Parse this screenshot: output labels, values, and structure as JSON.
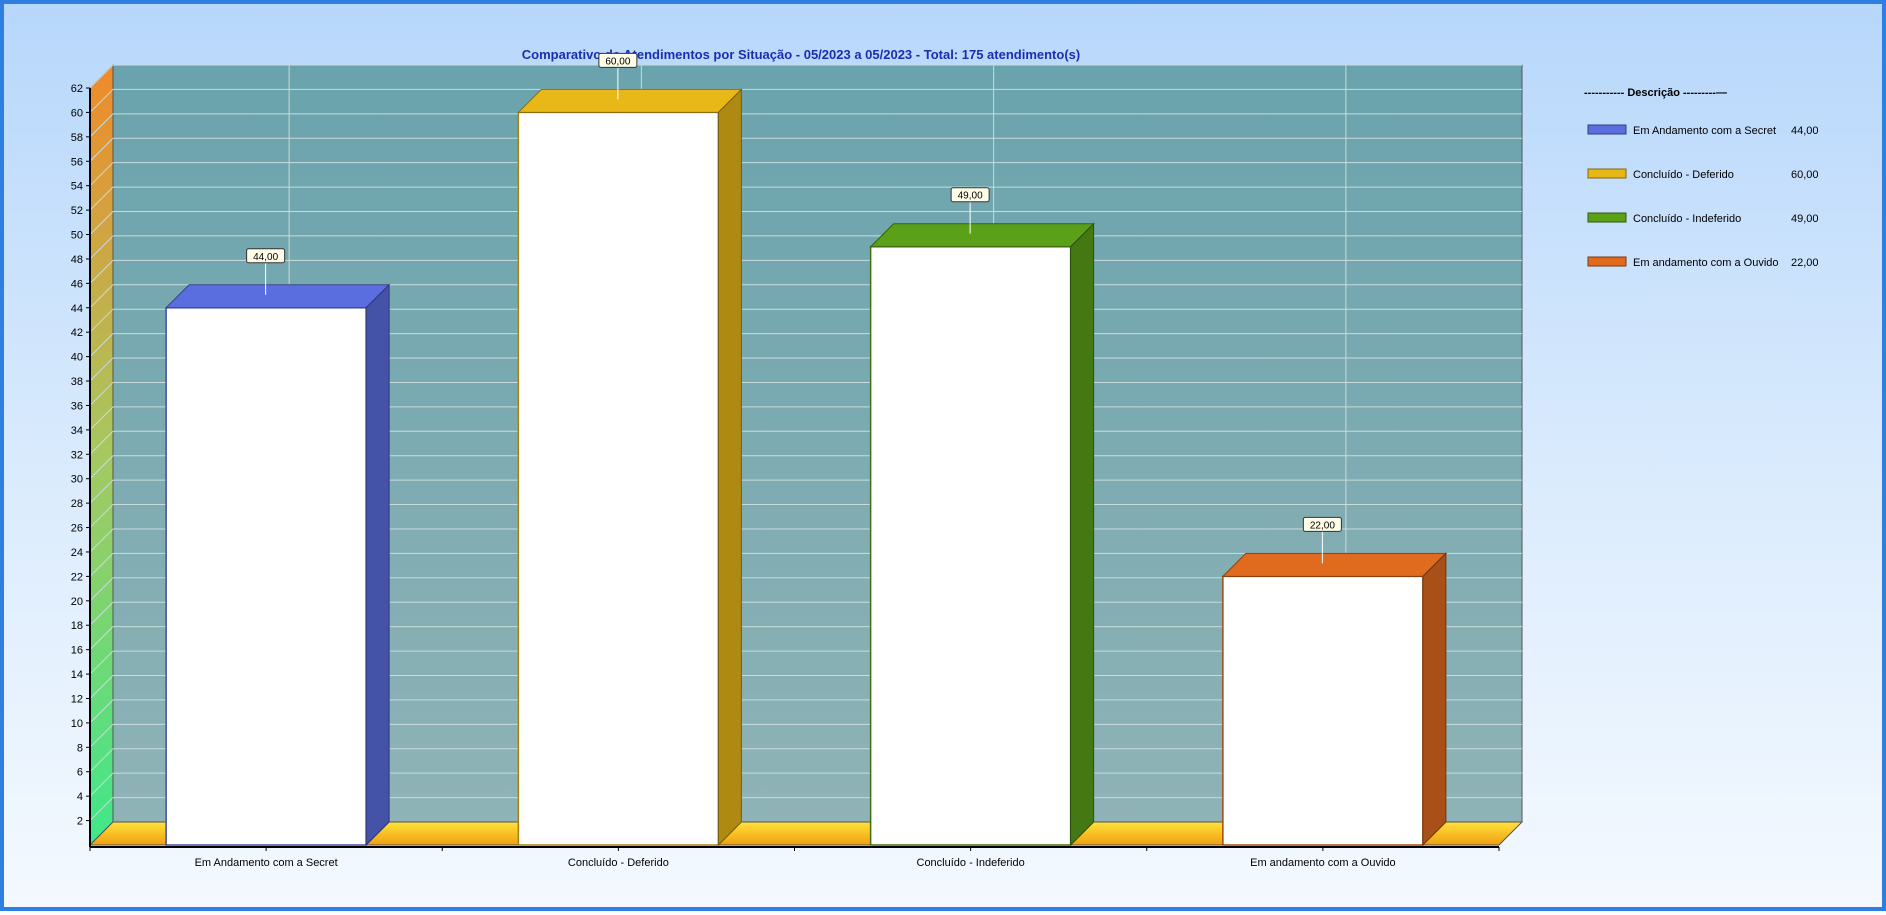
{
  "chart_data": {
    "type": "bar",
    "title": "Comparativo  de  Atendimentos  por  Situação  -  05/2023  a  05/2023  -  Total:  175  atendimento(s)",
    "categories": [
      "Em Andamento com a Secret",
      "Concluído - Deferido",
      "Concluído - Indeferido",
      "Em andamento com a Ouvido"
    ],
    "values": [
      44,
      60,
      49,
      22
    ],
    "data_labels": [
      "44,00",
      "60,00",
      "49,00",
      "22,00"
    ],
    "ylim": [
      0,
      62
    ],
    "yticks": [
      2,
      4,
      6,
      8,
      10,
      12,
      14,
      16,
      18,
      20,
      22,
      24,
      26,
      28,
      30,
      32,
      34,
      36,
      38,
      40,
      42,
      44,
      46,
      48,
      50,
      52,
      54,
      56,
      58,
      60,
      62
    ],
    "grid": true,
    "colors": [
      "#5a6ee0",
      "#e8b818",
      "#5aa018",
      "#e06a1e"
    ],
    "legend": {
      "position": "right",
      "heading": "----------- Descrição ---------—",
      "entries": [
        {
          "label": "Em Andamento com a Secret",
          "value": "44,00"
        },
        {
          "label": "Concluído - Deferido",
          "value": "60,00"
        },
        {
          "label": "Concluído - Indeferido",
          "value": "49,00"
        },
        {
          "label": "Em andamento com a Ouvido",
          "value": "22,00"
        }
      ]
    }
  }
}
